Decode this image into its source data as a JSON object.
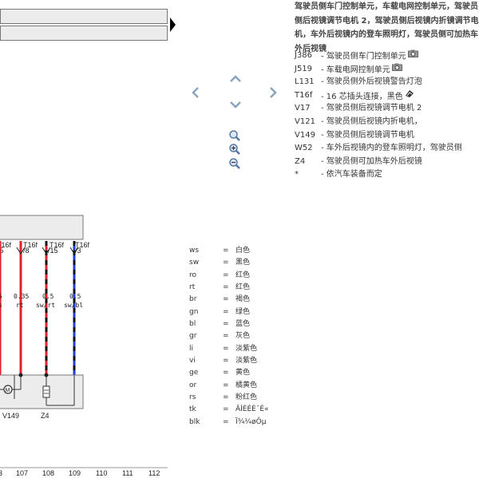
{
  "title": "驾驶员侧车门控制单元，车载电网控制单元，驾驶员侧后视镜调节电机 2，驾驶员侧后视镜内折镜调节电机，车外后视镜内的登车照明灯，驾驶员侧可加热车外后视镜",
  "legend": [
    {
      "code": "J386",
      "desc": "- 驾驶员侧车门控制单元",
      "icon": "camera-icon"
    },
    {
      "code": "J519",
      "desc": "- 车载电网控制单元",
      "icon": "camera-icon"
    },
    {
      "code": "L131",
      "desc": "- 驾驶员侧外后视镜警告灯泡",
      "icon": ""
    },
    {
      "code": "T16f",
      "desc": "- 16 芯插头连接，黑色",
      "icon": "connector-icon"
    },
    {
      "code": "V17",
      "desc": "- 驾驶员侧后视镜调节电机 2",
      "icon": ""
    },
    {
      "code": "V121",
      "desc": "- 驾驶员侧后视镜内折电机，",
      "icon": ""
    },
    {
      "code": "V149",
      "desc": "- 驾驶员侧后视镜调节电机",
      "icon": ""
    },
    {
      "code": "W52",
      "desc": "- 车外后视镜内的登车照明灯，驾驶员侧",
      "icon": ""
    },
    {
      "code": "Z4",
      "desc": "- 驾驶员侧可加热车外后视镜",
      "icon": ""
    },
    {
      "code": "*",
      "desc": "- 依汽车装备而定",
      "icon": ""
    }
  ],
  "colors": [
    {
      "code": "ws",
      "eq": "=",
      "name": "白色"
    },
    {
      "code": "sw",
      "eq": "=",
      "name": "黑色"
    },
    {
      "code": "ro",
      "eq": "=",
      "name": "红色"
    },
    {
      "code": "rt",
      "eq": "=",
      "name": "红色"
    },
    {
      "code": "br",
      "eq": "=",
      "name": "褐色"
    },
    {
      "code": "gn",
      "eq": "=",
      "name": "绿色"
    },
    {
      "code": "bl",
      "eq": "=",
      "name": "蓝色"
    },
    {
      "code": "gr",
      "eq": "=",
      "name": "灰色"
    },
    {
      "code": "li",
      "eq": "=",
      "name": "淡紫色"
    },
    {
      "code": "vi",
      "eq": "=",
      "name": "淡紫色"
    },
    {
      "code": "ge",
      "eq": "=",
      "name": "黄色"
    },
    {
      "code": "or",
      "eq": "=",
      "name": "橘黄色"
    },
    {
      "code": "rs",
      "eq": "=",
      "name": "粉红色"
    },
    {
      "code": "tk",
      "eq": "=",
      "name": "ÂÌÉÉÈ¯É«"
    },
    {
      "code": "blk",
      "eq": "=",
      "name": "Ï¾¼øÔµ"
    }
  ],
  "diagram": {
    "connectors": [
      {
        "top": "T16f",
        "pin": "/5"
      },
      {
        "top": "T16f",
        "pin": "/8"
      },
      {
        "top": "T16f",
        "pin": "/15"
      },
      {
        "top": "T16f",
        "pin": "/3"
      }
    ],
    "wires": [
      {
        "size": "5",
        "color": "s"
      },
      {
        "size": "0.35",
        "color": "rt"
      },
      {
        "size": "0.5",
        "color": "sw/rt"
      },
      {
        "size": "0.5",
        "color": "sw/bl"
      }
    ],
    "components": {
      "left": "V149",
      "right": "Z4"
    },
    "positions": [
      "3",
      "107",
      "108",
      "109",
      "110",
      "111",
      "112"
    ]
  },
  "nav": {
    "up": "chevron-up-icon",
    "down": "chevron-down-icon",
    "left": "chevron-left-icon",
    "right": "chevron-right-icon",
    "zoom_fit": "zoom-icon",
    "zoom_in": "zoom-in-icon",
    "zoom_out": "zoom-out-icon"
  }
}
